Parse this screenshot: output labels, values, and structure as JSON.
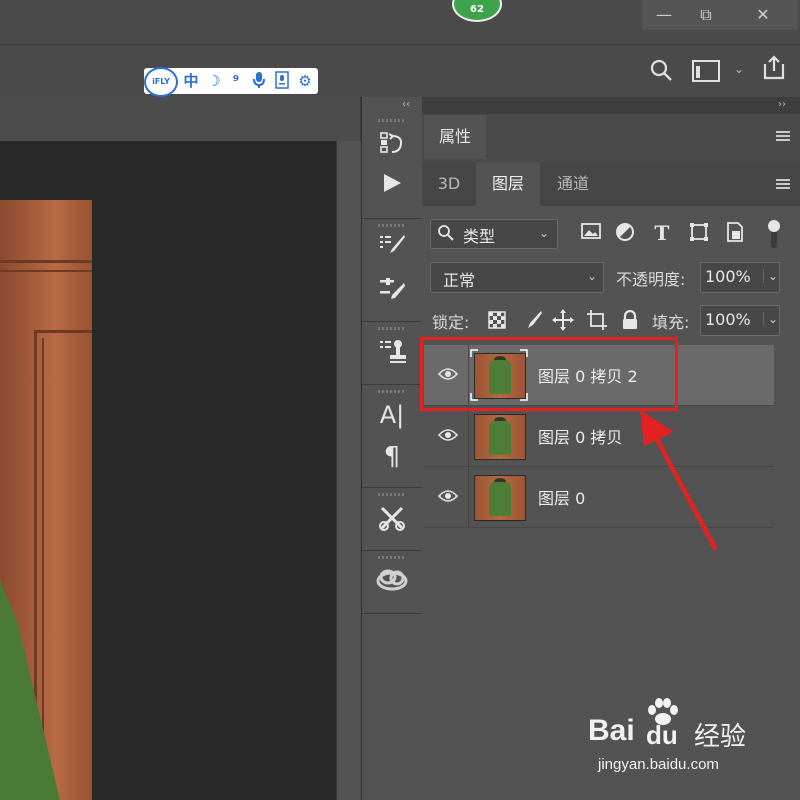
{
  "titlebar": {
    "badge_count": "62",
    "minimize": "—",
    "restore": "⧉",
    "close": "✕"
  },
  "ifly": {
    "logo": "iFLY",
    "items": [
      "中",
      "☽",
      "⁹",
      "🎤",
      "▣",
      "⚙"
    ]
  },
  "panel": {
    "properties_tab": "属性",
    "tabs": [
      "3D",
      "图层",
      "通道"
    ],
    "active_tab": "图层",
    "filter_kind": "类型",
    "blend_mode": "正常",
    "opacity_label": "不透明度:",
    "opacity_value": "100%",
    "lock_label": "锁定:",
    "fill_label": "填充:",
    "fill_value": "100%"
  },
  "layers": [
    {
      "name": "图层 0 拷贝 2",
      "selected": true,
      "visible": true
    },
    {
      "name": "图层 0 拷贝",
      "selected": false,
      "visible": true
    },
    {
      "name": "图层 0",
      "selected": false,
      "visible": true
    }
  ],
  "tools": [
    "history-icon",
    "play-icon",
    "brush-preset-icon",
    "brush-settings-icon",
    "clone-source-icon",
    "character-icon",
    "paragraph-icon",
    "tool-presets-icon",
    "creative-cloud-icon"
  ],
  "character_tool_glyph": "A|",
  "paragraph_tool_glyph": "¶",
  "watermark": {
    "brand": "Bai",
    "brand2": "du",
    "suffix": "经验",
    "url": "jingyan.baidu.com"
  },
  "colors": {
    "accent_red": "#e42222",
    "panel_bg": "#535353",
    "ifly_blue": "#2b6fd6"
  }
}
